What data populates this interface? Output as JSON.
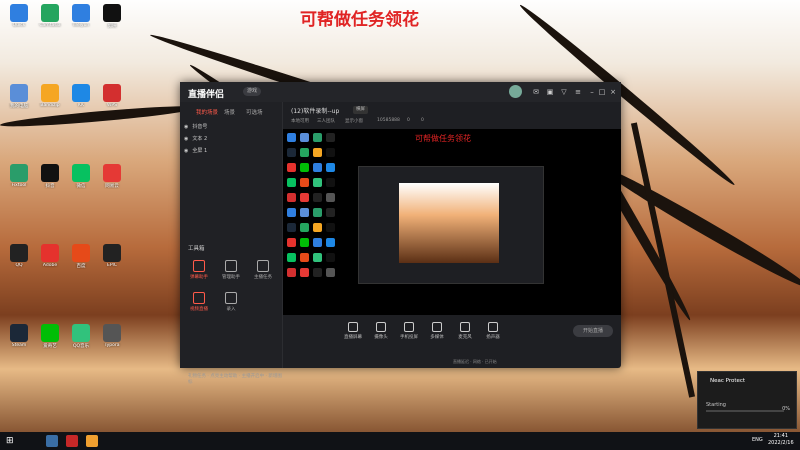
{
  "overlay_title": "可帮做任务领花",
  "desktop_icons": [
    {
      "label": "Quick",
      "color": "#2f7fe0"
    },
    {
      "label": "我的电脑",
      "color": "#5a8ed8"
    },
    {
      "label": "Fixtool",
      "color": "#2a9d6a"
    },
    {
      "label": "QQ",
      "color": "#222"
    },
    {
      "label": "Steam",
      "color": "#1b2838"
    },
    {
      "label": "Camtasia",
      "color": "#25a55f"
    },
    {
      "label": "Bandizip",
      "color": "#f5a623"
    },
    {
      "label": "抖音",
      "color": "#111"
    },
    {
      "label": "Adobe",
      "color": "#e5322d"
    },
    {
      "label": "爱奇艺",
      "color": "#00be06"
    },
    {
      "label": "Weiyun",
      "color": "#2f7fe0"
    },
    {
      "label": "KK",
      "color": "#1e88e5"
    },
    {
      "label": "微信",
      "color": "#07c160"
    },
    {
      "label": "百度",
      "color": "#e64a19"
    },
    {
      "label": "QQ音乐",
      "color": "#31c27c"
    },
    {
      "label": "剪映",
      "color": "#111"
    },
    {
      "label": "WPS",
      "color": "#d32f2f"
    },
    {
      "label": "网易云",
      "color": "#e53935"
    },
    {
      "label": "EPIC",
      "color": "#222"
    },
    {
      "label": "Typora",
      "color": "#555"
    }
  ],
  "window": {
    "logo": "直播伴侣",
    "version_badge": "游戏",
    "sidebar": {
      "tabs": [
        "我的场景",
        "场景",
        "可选场"
      ],
      "scenes": [
        "抖音号",
        "文本 2",
        "全屏 1"
      ],
      "tools_title": "工具箱",
      "tools": [
        "弹幕助手",
        "管理助手",
        "主播任务",
        "视频直播",
        "录入"
      ],
      "footer": "礼物任务 · 点亮主动帮助 · 主播开启中 · 新增图标"
    },
    "room": {
      "title": "(12)软件录制--up",
      "tag": "横屏",
      "info_items": [
        "本地可用",
        "三人团队",
        "显示小窗",
        "10585888",
        "0",
        "0"
      ]
    },
    "preview_overlay_text": "可帮做任务领花",
    "controls": [
      "直播屏幕",
      "摄像头",
      "手机投屏",
      "多媒体",
      "麦克风",
      "扬声器"
    ],
    "start_button": "开始直播",
    "status_text": "直播延迟 · 网络 · 已开始"
  },
  "notification": {
    "title": "Neac Protect",
    "status": "Starting",
    "percent": "0%",
    "progress": 0.0
  },
  "taskbar": {
    "tray_lang": "ENG",
    "time": "21:41",
    "date": "2022/2/16"
  }
}
